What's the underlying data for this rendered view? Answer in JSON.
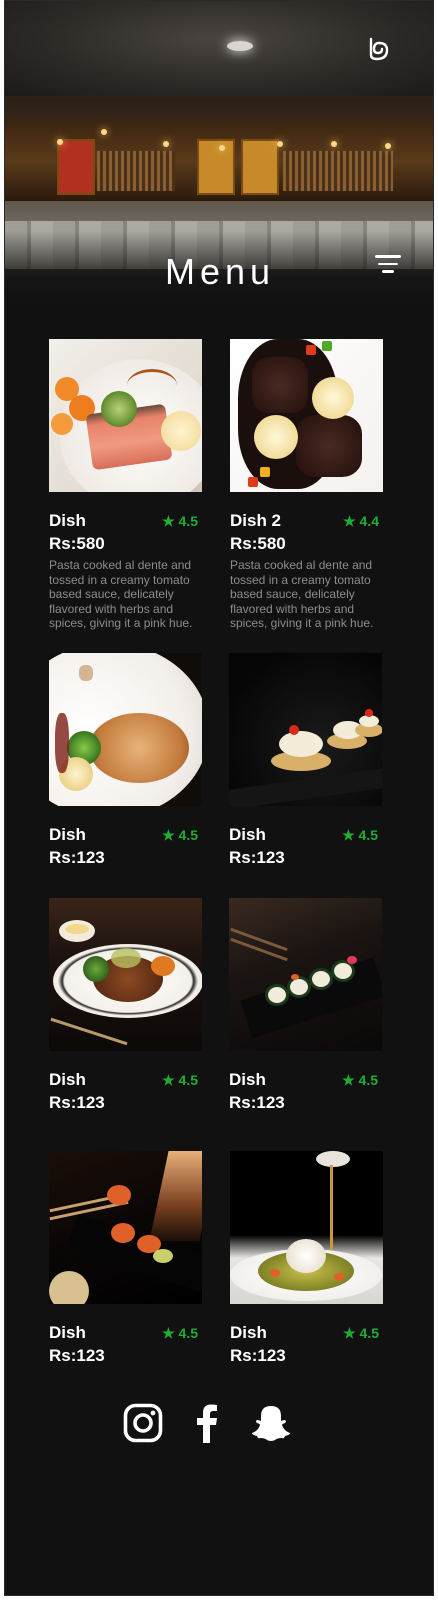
{
  "page": {
    "title": "Menu"
  },
  "colors": {
    "background": "#111111",
    "rating": "#1fae32",
    "text": "#ffffff",
    "description": "#8d8d8d"
  },
  "icons": {
    "logo": "spiral-logo-icon",
    "filter": "filter-lines-icon",
    "star": "star-icon"
  },
  "dishes": [
    {
      "name": "Dish",
      "rating": "4.5",
      "price": "Rs:580",
      "description": "Pasta cooked al dente and tossed in a creamy tomato based sauce, delicately flavored with herbs and spices, giving it a pink hue."
    },
    {
      "name": "Dish 2",
      "rating": "4.4",
      "price": "Rs:580",
      "description": "Pasta cooked al dente and tossed in a creamy tomato based sauce, delicately flavored with herbs and spices, giving it a pink hue."
    },
    {
      "name": "Dish",
      "rating": "4.5",
      "price": "Rs:123"
    },
    {
      "name": "Dish",
      "rating": "4.5",
      "price": "Rs:123"
    },
    {
      "name": "Dish",
      "rating": "4.5",
      "price": "Rs:123"
    },
    {
      "name": "Dish",
      "rating": "4.5",
      "price": "Rs:123"
    },
    {
      "name": "Dish",
      "rating": "4.5",
      "price": "Rs:123"
    },
    {
      "name": "Dish",
      "rating": "4.5",
      "price": "Rs:123"
    }
  ],
  "social": [
    {
      "icon": "instagram-icon"
    },
    {
      "icon": "facebook-icon"
    },
    {
      "icon": "snapchat-icon"
    }
  ]
}
